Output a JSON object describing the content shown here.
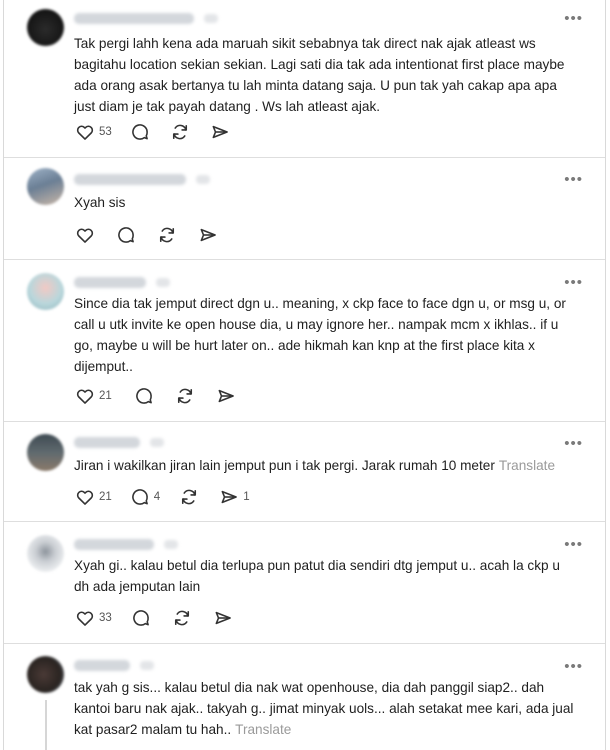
{
  "comments": [
    {
      "text": "Tak pergi lahh kena ada maruah sikit sebabnya tak direct nak ajak atleast ws bagitahu location sekian sekian. Lagi sati dia tak ada intentionat first place maybe ada orang asak bertanya tu lah minta datang saja. U pun tak yah cakap apa apa just diam je tak payah datang . Ws lah atleast ajak.",
      "like_count": "53",
      "reply_count": "",
      "share_count": "",
      "translate": ""
    },
    {
      "text": "Xyah sis",
      "like_count": "",
      "reply_count": "",
      "share_count": "",
      "translate": ""
    },
    {
      "text": "Since dia tak jemput direct dgn u.. meaning, x ckp face to face dgn u, or msg u, or call u utk invite ke open house dia, u may ignore her.. nampak mcm x ikhlas.. if u go, maybe u will be hurt later on.. ade hikmah kan knp at the first place kita x dijemput..",
      "like_count": "21",
      "reply_count": "",
      "share_count": "",
      "translate": ""
    },
    {
      "text": "Jiran i wakilkan jiran lain jemput pun i tak pergi. Jarak rumah 10 meter",
      "like_count": "21",
      "reply_count": "4",
      "share_count": "1",
      "translate": "Translate"
    },
    {
      "text": "Xyah gi.. kalau betul dia terlupa pun patut dia sendiri dtg jemput u.. acah la ckp u dh ada jemputan lain",
      "like_count": "33",
      "reply_count": "",
      "share_count": "",
      "translate": ""
    },
    {
      "text": "tak yah g sis... kalau betul dia nak wat openhouse, dia dah panggil siap2.. dah kantoi baru nak ajak.. takyah g.. jimat minyak uols... alah setakat mee kari, ada jual kat pasar2 malam tu hah..",
      "like_count": "",
      "reply_count": "",
      "share_count": "",
      "translate": "Translate"
    }
  ],
  "icons": {
    "like": "heart-icon",
    "reply": "comment-bubble-icon",
    "repost": "repost-arrows-icon",
    "share": "send-arrow-icon",
    "more": "more-options-icon"
  },
  "more_label": "•••",
  "colors": {
    "text": "#1f1f1f",
    "muted": "#9a9a9a",
    "icon": "#333333",
    "divider": "#dedede"
  }
}
